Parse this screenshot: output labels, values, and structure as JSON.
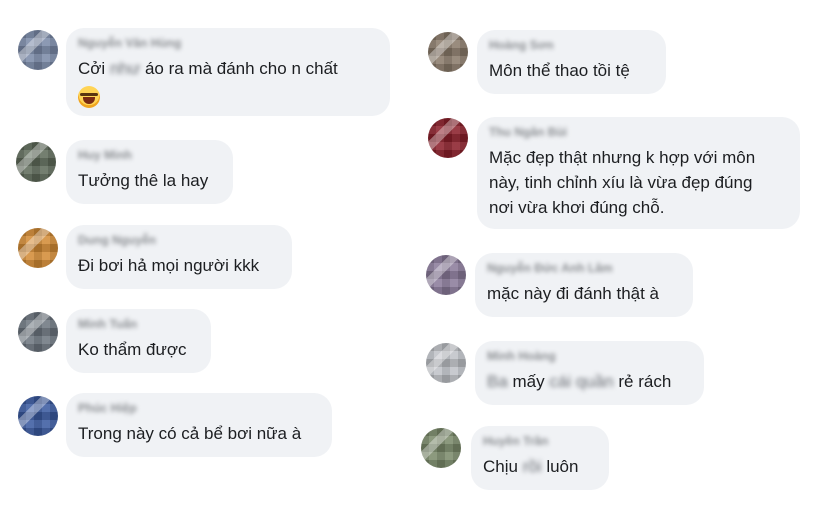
{
  "comments_left": [
    {
      "name": "Nguyễn Văn Hùng",
      "text_before": "Cởi ",
      "text_blur": "như",
      "text_after": " áo ra mà đánh cho n chất",
      "emoji": "laughing-crying-emoji",
      "avatar_color": "#7a8aa8"
    },
    {
      "name": "Huy Minh",
      "text": "Tưởng thê la hay",
      "avatar_color": "#5f6b5a"
    },
    {
      "name": "Dung Nguyễn",
      "text": "Đi bơi hả mọi người kkk",
      "avatar_color": "#d38b35"
    },
    {
      "name": "Minh Tuấn",
      "text": "Ko thẩm được",
      "avatar_color": "#6d7680"
    },
    {
      "name": "Phúc Hiệp",
      "text": "Trong này có cả bể bơi nữa à",
      "avatar_color": "#3a5aa0"
    }
  ],
  "comments_right": [
    {
      "name": "Hoàng Sơn",
      "text": "Môn thể thao tồi tệ",
      "avatar_color": "#8a7a6a"
    },
    {
      "name": "Thu Ngân Bùi",
      "text": "Mặc đẹp thật nhưng k hợp với môn\nnày, tinh chỉnh xíu là vừa đẹp đúng\nnơi vừa khơi đúng chỗ.",
      "avatar_color": "#8a1f2a"
    },
    {
      "name": "Nguyễn Đức Anh Lâm",
      "text": "mặc này đi đánh thật à",
      "avatar_color": "#8a7a9a"
    },
    {
      "name": "Minh Hoàng",
      "text_blur1": "Ba",
      "text_mid": " mấy ",
      "text_blur2": "cái quần",
      "text_after": " rẻ rách",
      "avatar_color": "#c0c3c8"
    },
    {
      "name": "Huyền Trần",
      "text_before": "Chịu ",
      "text_blur": "rồi",
      "text_after": " luôn",
      "avatar_color": "#7a8a6a"
    }
  ]
}
